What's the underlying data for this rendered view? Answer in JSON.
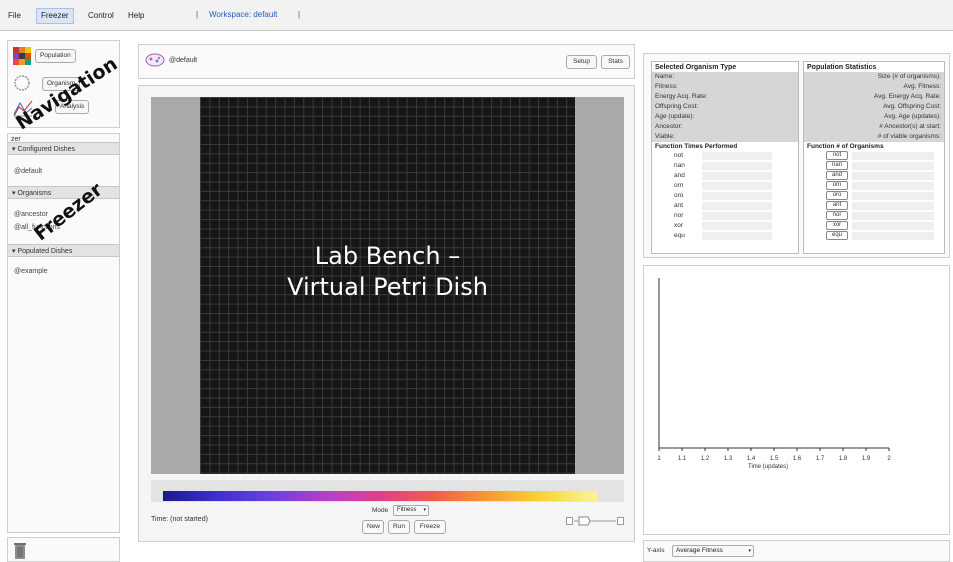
{
  "menu": {
    "file": "File",
    "freezer": "Freezer",
    "control": "Control",
    "help": "Help",
    "sep": "|",
    "workspace": "Workspace: default"
  },
  "nav": {
    "populated_btn": "Population",
    "organism_btn": "Organism",
    "analysis_btn": "Analysis"
  },
  "overlay": {
    "navigation": "Navigation",
    "freezer": "Freezer",
    "lab_line1": "Lab Bench –",
    "lab_line2": "Virtual Petri Dish"
  },
  "freezer": {
    "label": "zer",
    "configured": {
      "header": "▾ Configured Dishes",
      "items": [
        "@default"
      ]
    },
    "organisms": {
      "header": "▾ Organisms",
      "items": [
        "@ancestor",
        "@all_functions"
      ]
    },
    "populated": {
      "header": "▾ Populated Dishes",
      "items": [
        "@example"
      ]
    }
  },
  "center": {
    "dish_name": "@default",
    "setup": "Setup",
    "stats": "Stats",
    "time": "Time: (not started)",
    "mode_label": "Mode",
    "mode_value": "Fitness",
    "new_btn": "New",
    "run_btn": "Run",
    "freeze_btn": "Freeze"
  },
  "organism_panel": {
    "title": "Selected Organism Type",
    "fields": [
      "Name:",
      "Fitness:",
      "Energy Acq. Rate:",
      "Offspring Cost:",
      "Age (update):",
      "Ancestor:",
      "Viable:"
    ],
    "fn_header": "Function  Times Performed",
    "functions": [
      "not",
      "nan",
      "and",
      "orn",
      "oro",
      "ant",
      "nor",
      "xor",
      "equ"
    ]
  },
  "population_panel": {
    "title": "Population Statistics",
    "fields": [
      "Size (# of organisms):",
      "Avg. Fitness:",
      "Avg. Energy Acq. Rate:",
      "Avg. Offspring Cost:",
      "Avg. Age (updates):",
      "# Ancestor(s) at start:",
      "# of viable organisms:"
    ],
    "fn_header": "Function  # of Organisms",
    "functions": [
      "not",
      "nan",
      "and",
      "orn",
      "oro",
      "ant",
      "nor",
      "xor",
      "equ"
    ]
  },
  "chart": {
    "x_ticks": [
      "1",
      "1.1",
      "1.2",
      "1.3",
      "1.4",
      "1.5",
      "1.6",
      "1.7",
      "1.8",
      "1.9",
      "2"
    ],
    "x_label": "Time (updates)"
  },
  "yaxis": {
    "label": "Y-axis",
    "value": "Average Fitness"
  },
  "colors": {
    "accent": "#1e5fbf",
    "dish": "#161616",
    "panel_grey": "#d6d6d6"
  }
}
